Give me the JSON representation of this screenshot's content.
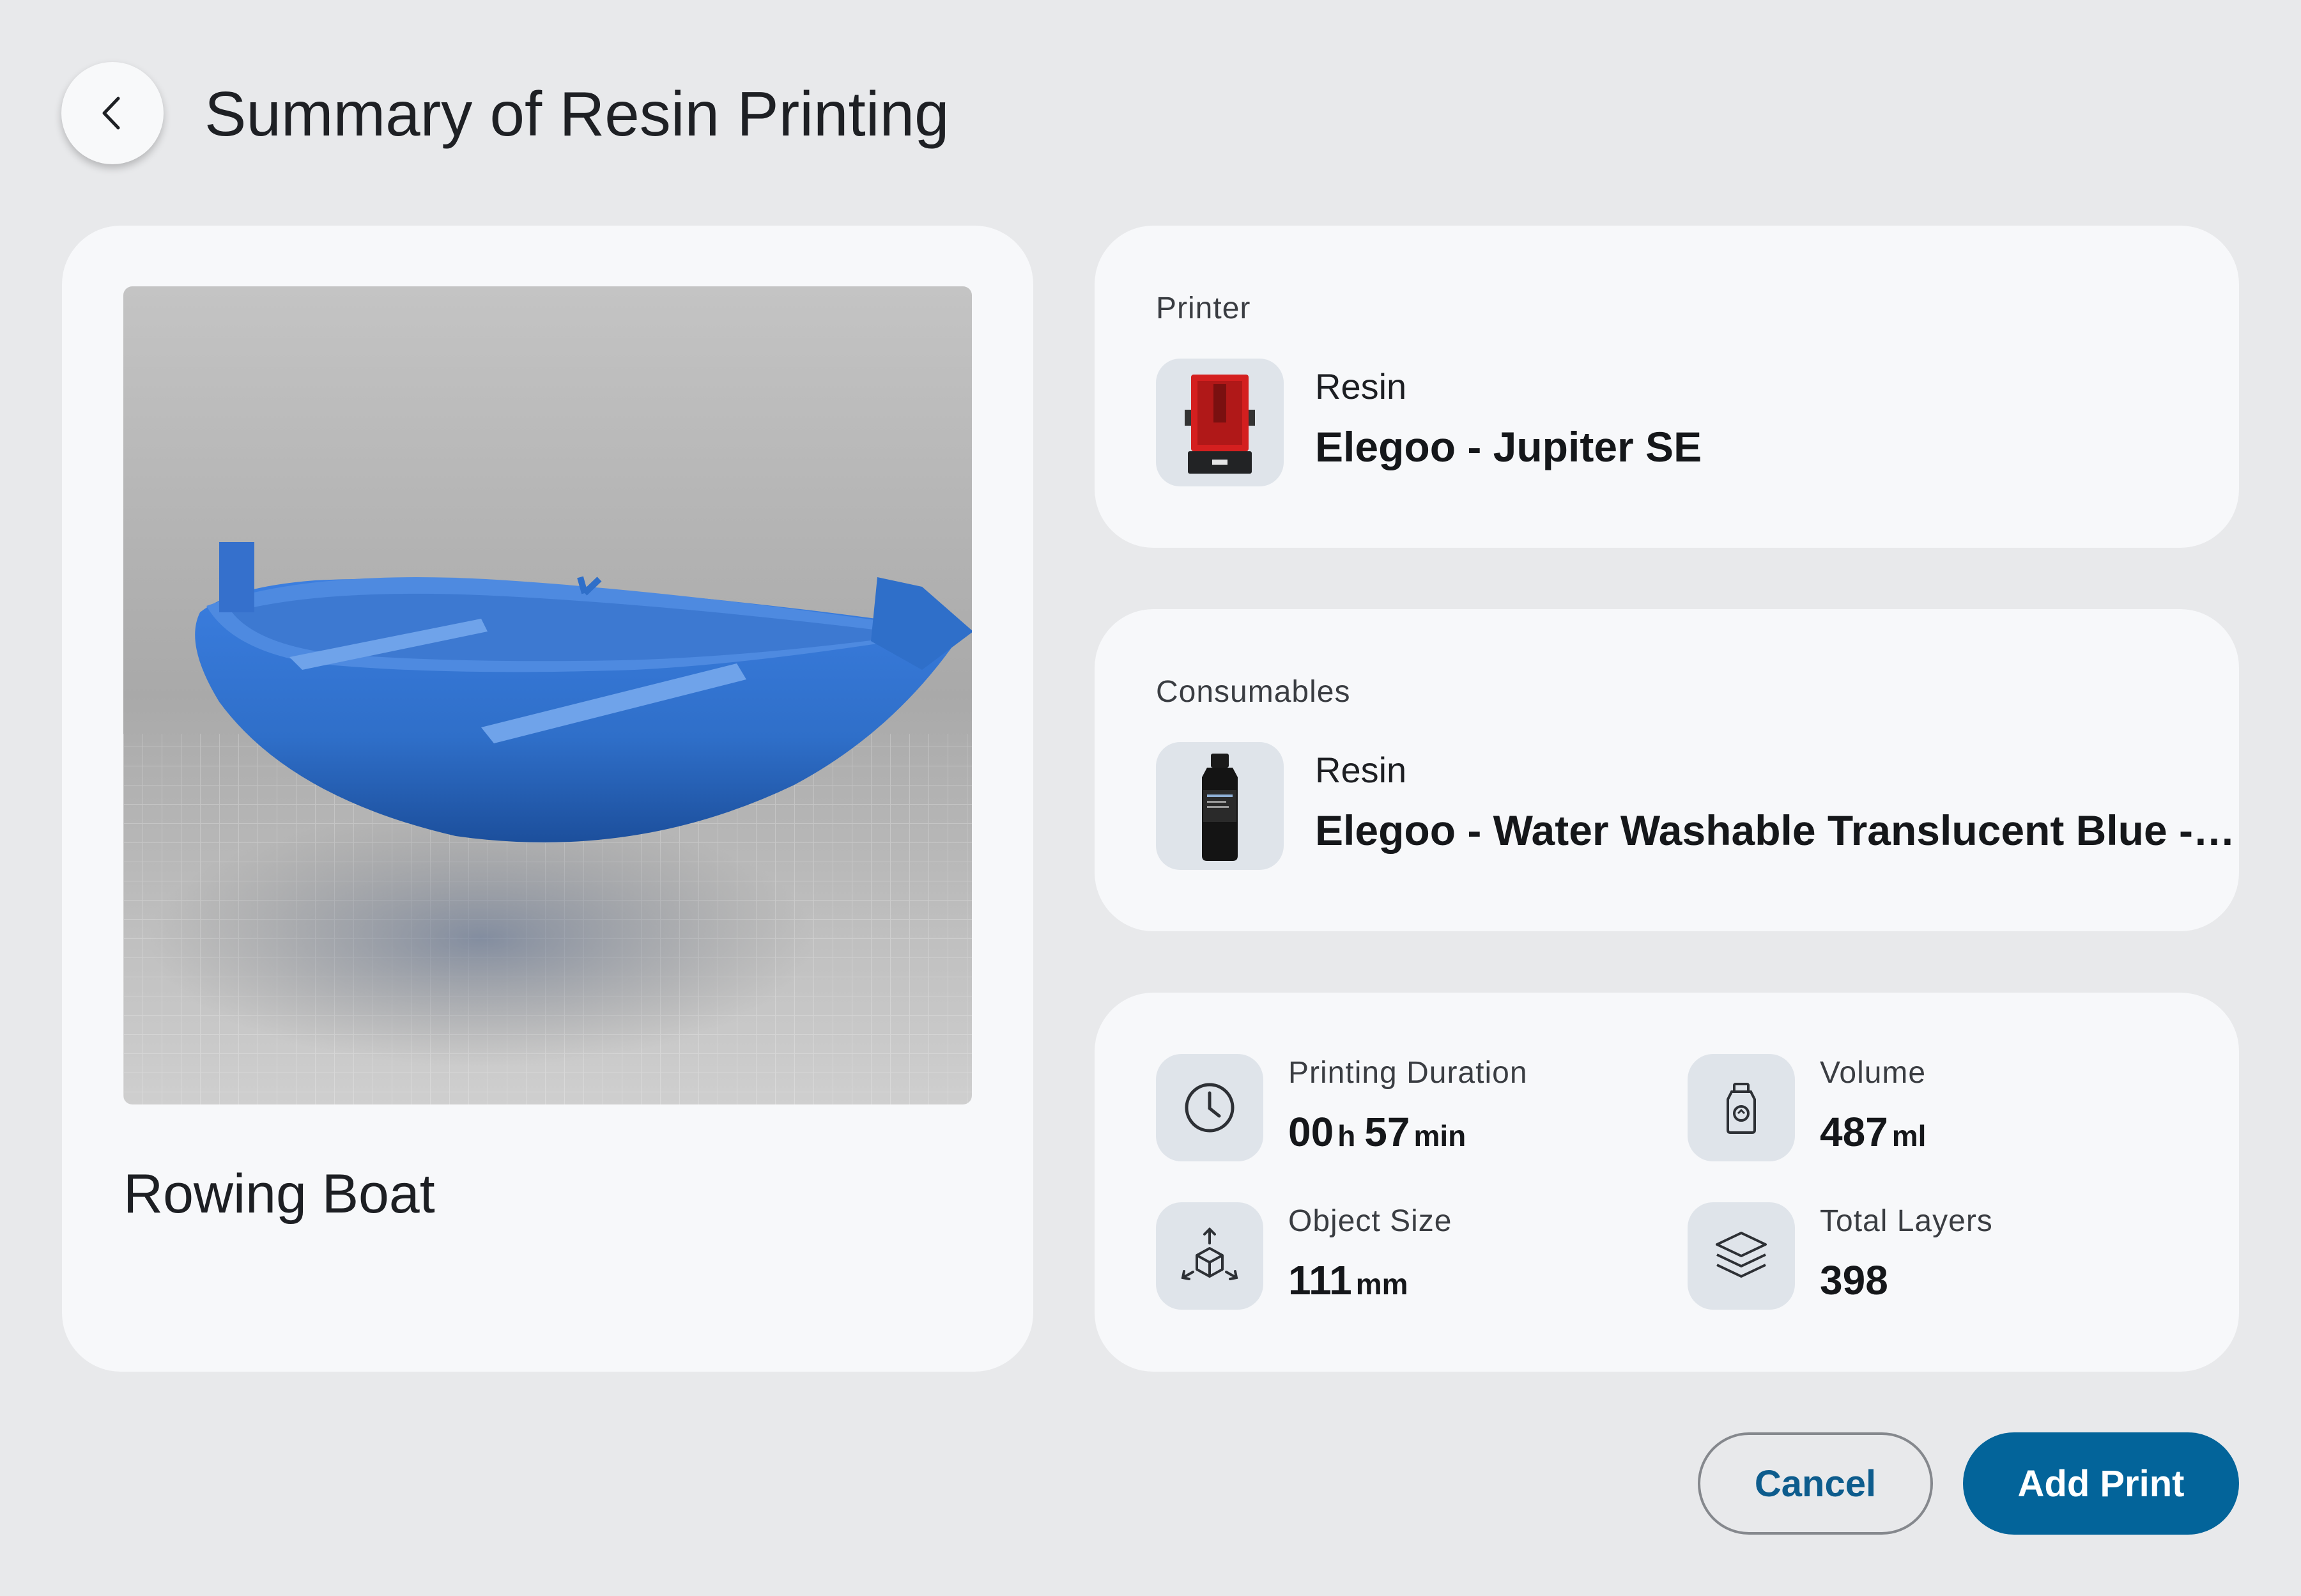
{
  "header": {
    "title": "Summary of Resin Printing"
  },
  "model": {
    "name": "Rowing Boat"
  },
  "printer": {
    "label": "Printer",
    "type": "Resin",
    "name": "Elegoo - Jupiter SE"
  },
  "consumables": {
    "label": "Consumables",
    "type": "Resin",
    "name": "Elegoo - Water Washable Translucent Blue -…"
  },
  "stats": {
    "duration": {
      "label": "Printing Duration",
      "hours": "00",
      "hours_unit": "h",
      "minutes": "57",
      "minutes_unit": "min"
    },
    "volume": {
      "label": "Volume",
      "value": "487",
      "unit": "ml"
    },
    "size": {
      "label": "Object Size",
      "value": "111",
      "unit": "mm"
    },
    "layers": {
      "label": "Total Layers",
      "value": "398"
    }
  },
  "actions": {
    "cancel_label": "Cancel",
    "add_label": "Add Print"
  },
  "colors": {
    "primary": "#03649a",
    "background": "#e8e9eb",
    "card": "#f7f8fa",
    "model": "#2f6fc9"
  }
}
